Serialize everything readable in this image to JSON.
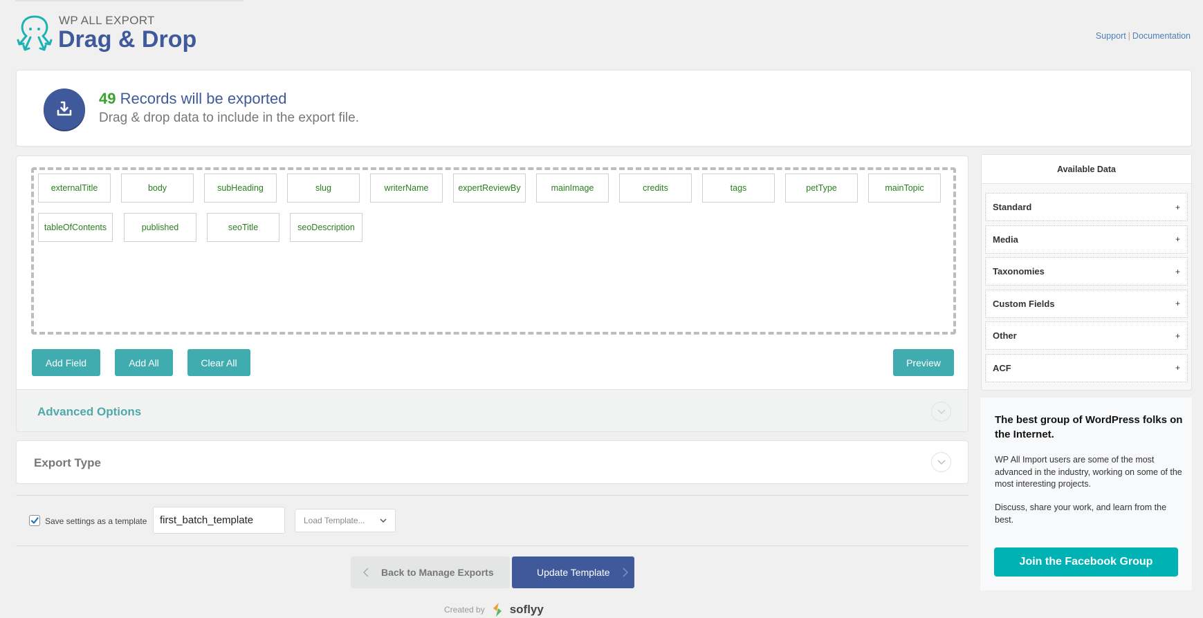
{
  "header": {
    "brand_small": "WP ALL EXPORT",
    "title": "Drag & Drop",
    "links": {
      "support": "Support",
      "separator": "|",
      "documentation": "Documentation"
    }
  },
  "records": {
    "count": "49",
    "line1_suffix": " Records will be exported",
    "line2": "Drag & drop data to include in the export file."
  },
  "fields": [
    "externalTitle",
    "body",
    "subHeading",
    "slug",
    "writerName",
    "expertReviewBy",
    "mainImage",
    "credits",
    "tags",
    "petType",
    "mainTopic",
    "tableOfContents",
    "published",
    "seoTitle",
    "seoDescription"
  ],
  "buttons": {
    "add_field": "Add Field",
    "add_all": "Add All",
    "clear_all": "Clear All",
    "preview": "Preview"
  },
  "sections": {
    "advanced_options": "Advanced Options",
    "export_type": "Export Type"
  },
  "template": {
    "save_checked": true,
    "save_label": "Save settings as a template",
    "name_value": "first_batch_template",
    "load_placeholder": "Load Template..."
  },
  "footer_buttons": {
    "back": "Back to Manage Exports",
    "update": "Update Template"
  },
  "credit": {
    "prefix": "Created by",
    "brand": "soflyy"
  },
  "available_data": {
    "title": "Available Data",
    "groups": [
      "Standard",
      "Media",
      "Taxonomies",
      "Custom Fields",
      "Other",
      "ACF"
    ],
    "expand_symbol": "+"
  },
  "promo": {
    "title": "The best group of WordPress folks on the Internet.",
    "p1": "WP All Import users are some of the most advanced in the industry, working on some of the most interesting projects.",
    "p2": "Discuss, share your work, and learn from the best.",
    "button": "Join the Facebook Group"
  },
  "colors": {
    "brand_blue": "#40599a",
    "teal_button": "#40acaf",
    "count_green": "#3ba22e",
    "field_text_green": "#2a7d1f",
    "facebook_teal": "#00b2b4"
  }
}
